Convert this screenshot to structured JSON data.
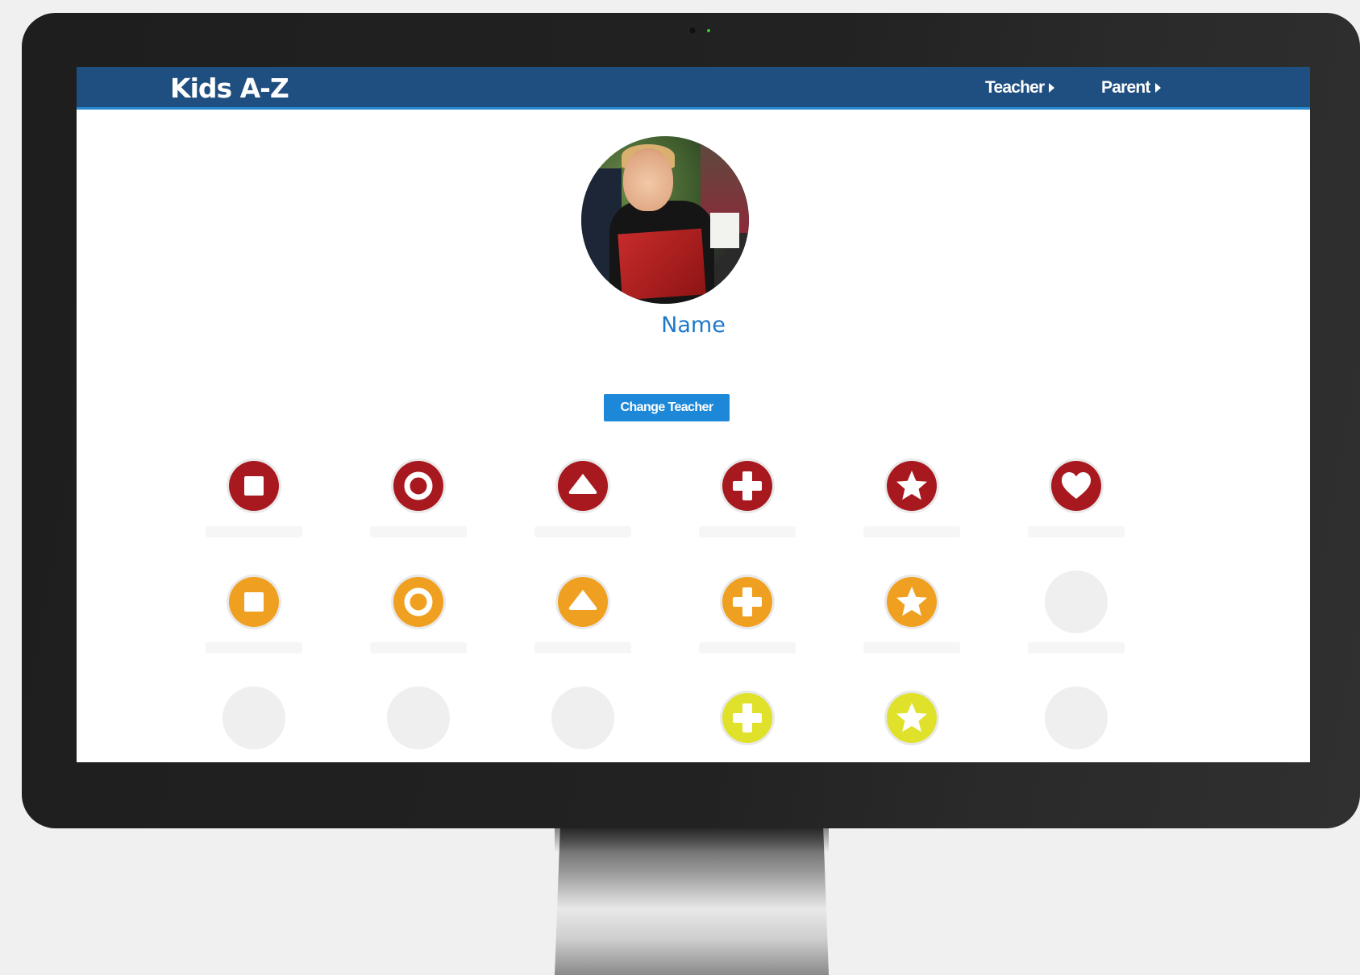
{
  "app": {
    "brand": "Kids A-Z"
  },
  "nav": {
    "teacher_label": "Teacher",
    "parent_label": "Parent"
  },
  "profile": {
    "name": "Name",
    "change_teacher_label": "Change Teacher"
  },
  "colors": {
    "header": "#1f4f80",
    "header_accent": "#2a8ad0",
    "name_text": "#1e78c8",
    "button": "#1e88d8",
    "award_red": "#a8191f",
    "award_orange": "#f0a021",
    "award_yellow": "#dfe12a",
    "award_locked": "#efefef"
  },
  "awards": {
    "rows": [
      [
        {
          "shape": "square-icon",
          "color": "red",
          "earned": true
        },
        {
          "shape": "circle-icon",
          "color": "red",
          "earned": true
        },
        {
          "shape": "triangle-icon",
          "color": "red",
          "earned": true
        },
        {
          "shape": "plus-icon",
          "color": "red",
          "earned": true
        },
        {
          "shape": "star-icon",
          "color": "red",
          "earned": true
        },
        {
          "shape": "heart-icon",
          "color": "red",
          "earned": true
        }
      ],
      [
        {
          "shape": "square-icon",
          "color": "orange",
          "earned": true
        },
        {
          "shape": "circle-icon",
          "color": "orange",
          "earned": true
        },
        {
          "shape": "triangle-icon",
          "color": "orange",
          "earned": true
        },
        {
          "shape": "plus-icon",
          "color": "orange",
          "earned": true
        },
        {
          "shape": "star-icon",
          "color": "orange",
          "earned": true
        },
        {
          "shape": "locked",
          "color": "gray",
          "earned": false
        }
      ],
      [
        {
          "shape": "locked",
          "color": "gray",
          "earned": false
        },
        {
          "shape": "locked",
          "color": "gray",
          "earned": false
        },
        {
          "shape": "locked",
          "color": "gray",
          "earned": false
        },
        {
          "shape": "plus-icon",
          "color": "yellow",
          "earned": true
        },
        {
          "shape": "star-icon",
          "color": "yellow",
          "earned": true
        },
        {
          "shape": "locked",
          "color": "gray",
          "earned": false
        }
      ]
    ]
  }
}
